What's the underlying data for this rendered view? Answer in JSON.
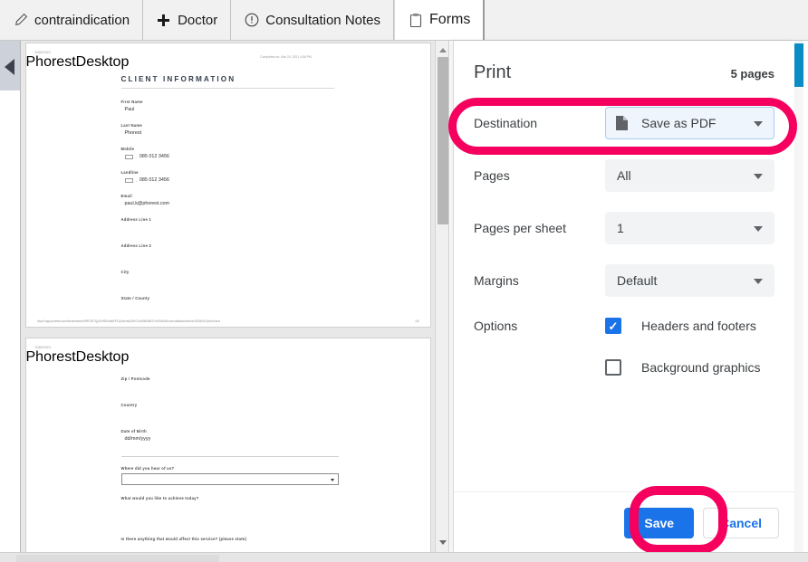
{
  "tabs": [
    {
      "label": "contraindication",
      "icon": "pencil-icon",
      "active": false
    },
    {
      "label": "Doctor",
      "icon": "plus-icon",
      "active": false
    },
    {
      "label": "Consultation Notes",
      "icon": "exclamation-circle-icon",
      "active": false
    },
    {
      "label": "Forms",
      "icon": "clipboard-icon",
      "active": true
    }
  ],
  "preview": {
    "collapse_arrow": "left-triangle-icon",
    "scroll_up": "scroll-up-arrow",
    "scroll_down": "scroll-down-arrow",
    "page1": {
      "header_date": "3/30/2021",
      "header_app": "PhorestDesktop",
      "header_completed": "Completed on: Mar 24, 2021 4:06 PM",
      "title": "CLIENT INFORMATION",
      "fields": [
        {
          "label": "First Name",
          "value": "Paul"
        },
        {
          "label": "Last Name",
          "value": "Phorest"
        },
        {
          "label": "Mobile",
          "value": "085 012 3456",
          "type": "phone"
        },
        {
          "label": "Landline",
          "value": "085 012 3456",
          "type": "phone"
        },
        {
          "label": "Email",
          "value": "paul.k@phorest.com"
        },
        {
          "label": "Address Line 1",
          "value": ""
        },
        {
          "label": "Address Line 2",
          "value": ""
        },
        {
          "label": "City",
          "value": ""
        },
        {
          "label": "State / County",
          "value": ""
        }
      ],
      "footer_url": "https://app.phorest.com/businesses/vIfRF3S7Qy3XrRDNuBKP1Q/clients/2bVC0u3W83MO1VsTfdU6A/consultations/forms/19300047/print=true",
      "footer_page": "1/5"
    },
    "page2": {
      "header_date": "3/30/2021",
      "header_app": "PhorestDesktop",
      "fields": [
        {
          "label": "Zip / Postcode",
          "value": ""
        },
        {
          "label": "Country",
          "value": ""
        },
        {
          "label": "Date of Birth",
          "value": "dd/mm/yyyy"
        }
      ],
      "questions": [
        {
          "label": "Where did you hear of us?",
          "type": "select"
        },
        {
          "label": "What would you like to achieve today?",
          "type": "text"
        },
        {
          "label": "Is there anything that would affect this service? (please state)",
          "type": "text"
        }
      ]
    }
  },
  "print_dialog": {
    "title": "Print",
    "page_count": "5 pages",
    "rows": [
      {
        "label": "Destination",
        "value": "Save as PDF",
        "icon": "pdf-file-icon",
        "focused": true
      },
      {
        "label": "Pages",
        "value": "All",
        "focused": false
      },
      {
        "label": "Pages per sheet",
        "value": "1",
        "focused": false
      },
      {
        "label": "Margins",
        "value": "Default",
        "focused": false
      }
    ],
    "options_label": "Options",
    "options": [
      {
        "label": "Headers and footers",
        "checked": true
      },
      {
        "label": "Background graphics",
        "checked": false
      }
    ],
    "save_label": "Save",
    "cancel_label": "Cancel"
  },
  "annotations": [
    {
      "name": "destination-highlight",
      "color": "#f5005e"
    },
    {
      "name": "save-highlight",
      "color": "#f5005e"
    }
  ],
  "colors": {
    "accent_blue": "#1a73e8",
    "annotation_pink": "#f5005e",
    "select_bg": "#f1f3f4",
    "focus_border": "#a8cbf0",
    "right_scroll_blue": "#0b8cc4"
  }
}
